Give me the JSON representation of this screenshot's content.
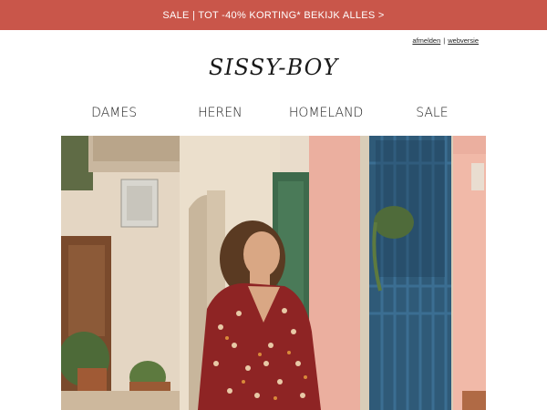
{
  "promo": {
    "text": "SALE | TOT -40% KORTING* BEKIJK ALLES >"
  },
  "utility": {
    "unsubscribe": "afmelden",
    "separator": "|",
    "web_version": "webversie"
  },
  "brand": {
    "logo_text": "SISSY-BOY"
  },
  "nav": {
    "items": [
      {
        "label": "DAMES"
      },
      {
        "label": "HEREN"
      },
      {
        "label": "HOMELAND"
      },
      {
        "label": "SALE"
      }
    ]
  },
  "hero": {
    "image_alt": "hero-photo"
  },
  "colors": {
    "promo_bg": "#c9564a",
    "text": "#222222",
    "background": "#ffffff"
  }
}
